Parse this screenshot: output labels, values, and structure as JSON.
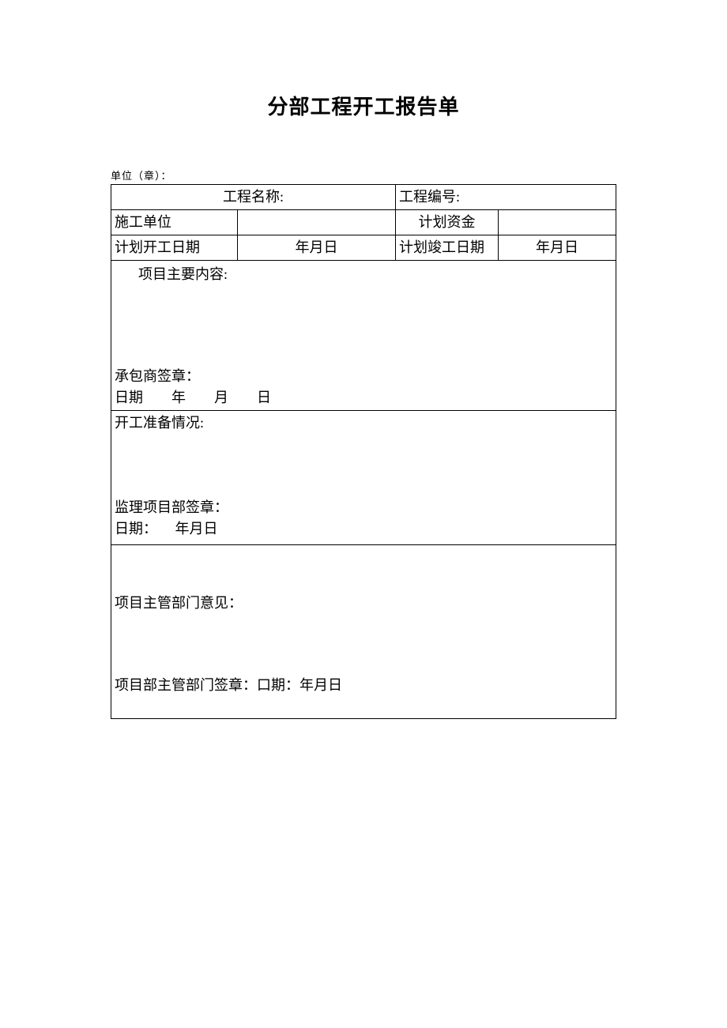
{
  "title": "分部工程开工报告单",
  "unit_label": "单位（章）：",
  "row1": {
    "project_name_label": "工程名称:",
    "project_number_label": "工程编号:"
  },
  "row2": {
    "construction_unit_label": "施工单位",
    "planned_fund_label": "计划资金"
  },
  "row3": {
    "planned_start_label": "计划开工日期",
    "planned_start_value": "年月日",
    "planned_end_label": "计划竣工日期",
    "planned_end_value": "年月日"
  },
  "main_content": {
    "header": "项目主要内容:",
    "contractor_sign": "承包商签章：",
    "date_line": "日期  年  月  日"
  },
  "prep": {
    "header": "开工准备情况:",
    "supervisor_sign": "监理项目部签章：",
    "date_line": "日期：  年月日"
  },
  "dept": {
    "opinion_label": "项目主管部门意见：",
    "sign_line": "项目部主管部门签章：口期：年月日"
  }
}
